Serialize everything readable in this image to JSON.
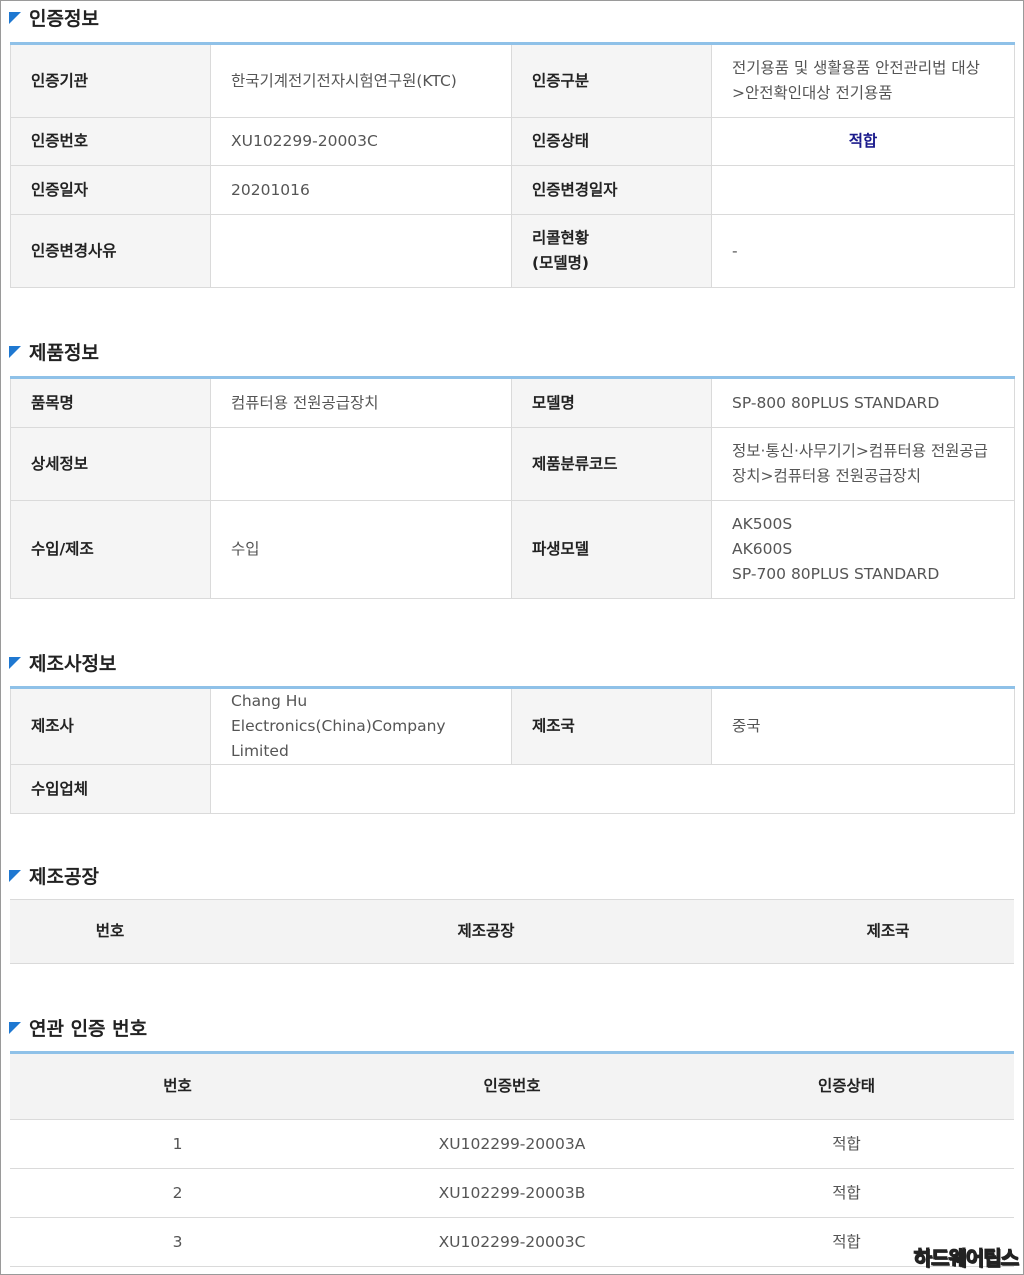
{
  "cert": {
    "title": "인증정보",
    "rows": [
      {
        "l1": "인증기관",
        "v1": "한국기계전기전자시험연구원(KTC)",
        "l2": "인증구분",
        "v2a": "전기용품 및 생활용품 안전관리법 대상",
        "v2b": ">안전확인대상 전기용품"
      },
      {
        "l1": "인증번호",
        "v1": "XU102299-20003C",
        "l2": "인증상태",
        "v2": "적합"
      },
      {
        "l1": "인증일자",
        "v1": "20201016",
        "l2": "인증변경일자",
        "v2": ""
      },
      {
        "l1": "인증변경사유",
        "v1": "",
        "l2a": "리콜현황",
        "l2b": "(모델명)",
        "v2": "-"
      }
    ]
  },
  "product": {
    "title": "제품정보",
    "rows": [
      {
        "l1": "품목명",
        "v1": "컴퓨터용 전원공급장치",
        "l2": "모델명",
        "v2": "SP-800 80PLUS STANDARD"
      },
      {
        "l1": "상세정보",
        "v1": "",
        "l2": "제품분류코드",
        "v2a": "정보·통신·사무기기>컴퓨터용 전원공급",
        "v2b": "장치>컴퓨터용 전원공급장치"
      },
      {
        "l1": "수입/제조",
        "v1": "수입",
        "l2": "파생모델",
        "v2a": "AK500S",
        "v2b": "AK600S",
        "v2c": "SP-700 80PLUS STANDARD"
      }
    ]
  },
  "maker": {
    "title": "제조사정보",
    "rows": [
      {
        "l1": "제조사",
        "v1a": "Chang Hu",
        "v1b": "Electronics(China)Company Limited",
        "l2": "제조국",
        "v2": "중국"
      },
      {
        "l1": "수입업체",
        "v1": ""
      }
    ]
  },
  "factory": {
    "title": "제조공장",
    "headers": [
      "번호",
      "제조공장",
      "제조국"
    ]
  },
  "related": {
    "title": "연관 인증 번호",
    "headers": [
      "번호",
      "인증번호",
      "인증상태"
    ],
    "rows": [
      {
        "no": "1",
        "cert_no": "XU102299-20003A",
        "status": "적합"
      },
      {
        "no": "2",
        "cert_no": "XU102299-20003B",
        "status": "적합"
      },
      {
        "no": "3",
        "cert_no": "XU102299-20003C",
        "status": "적합"
      }
    ]
  },
  "watermark": "하드웨어팁스",
  "colors": {
    "accent": "#1f78d1",
    "border_top": "#8fc1e8",
    "status": "#1a1a8c"
  }
}
